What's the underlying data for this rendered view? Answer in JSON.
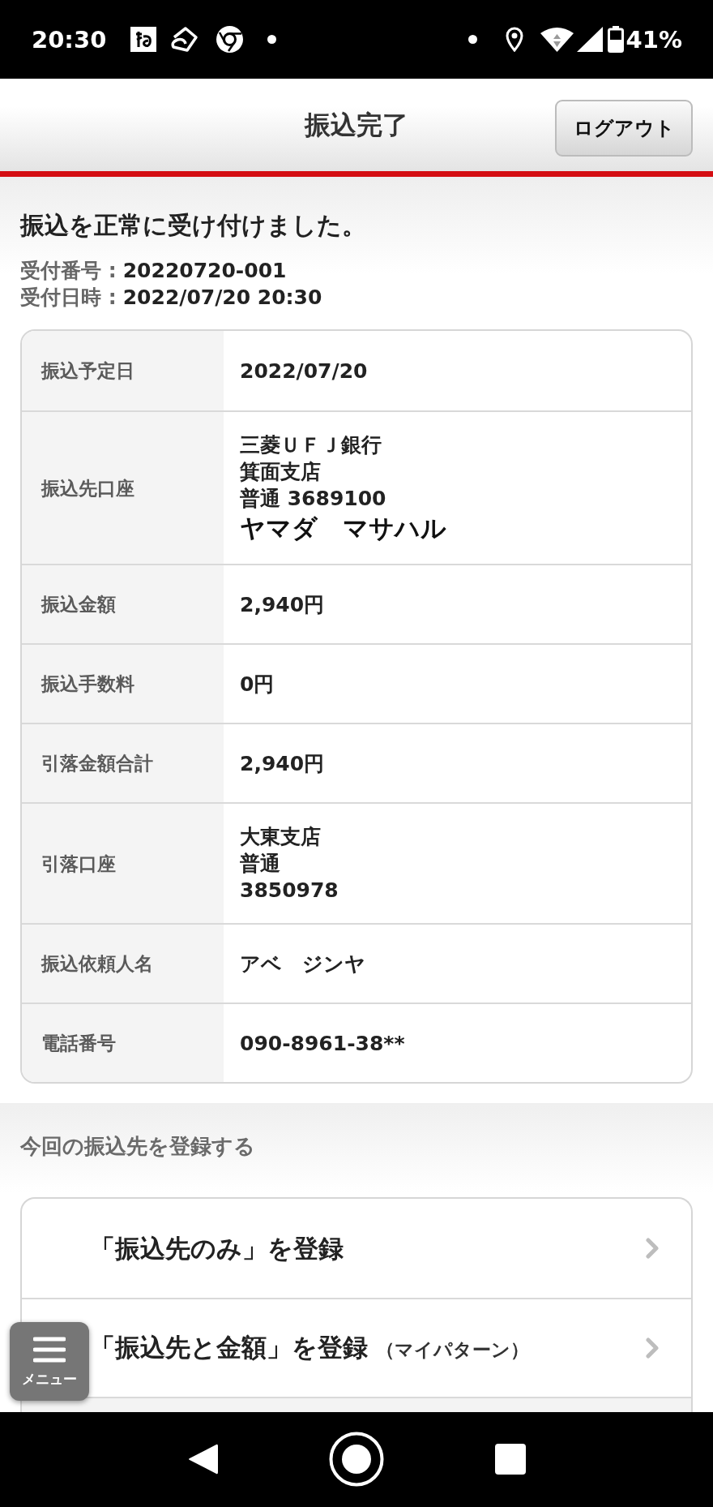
{
  "status_bar": {
    "time": "20:30",
    "battery": "41%"
  },
  "header": {
    "title": "振込完了",
    "logout_button": "ログアウト"
  },
  "message": "振込を正常に受け付けました。",
  "receipt": [
    {
      "label": "受付番号 :",
      "value": "20220720-001"
    },
    {
      "label": "受付日時 :",
      "value": "2022/07/20 20:30"
    }
  ],
  "details": [
    {
      "label": "振込予定日",
      "lines": [
        "2022/07/20"
      ]
    },
    {
      "label": "振込先口座",
      "lines": [
        "三菱ＵＦＪ銀行",
        "箕面支店",
        "普通 3689100"
      ],
      "payee_name": "ヤマダ　マサハル"
    },
    {
      "label": "振込金額",
      "lines": [
        "2,940円"
      ]
    },
    {
      "label": "振込手数料",
      "lines": [
        "0円"
      ]
    },
    {
      "label": "引落金額合計",
      "lines": [
        "2,940円"
      ]
    },
    {
      "label": "引落口座",
      "lines": [
        "大東支店",
        "普通",
        "3850978"
      ]
    },
    {
      "label": "振込依頼人名",
      "lines": [
        "アベ　ジンヤ"
      ]
    },
    {
      "label": "電話番号",
      "lines": [
        "090-8961-38**"
      ]
    }
  ],
  "register": {
    "heading": "今回の振込先を登録する",
    "items": [
      {
        "label": "「振込先のみ」を登録"
      },
      {
        "label": "「振込先と金額」を登録",
        "note": "（マイパターン）"
      }
    ]
  },
  "menu_button": {
    "label": "メニュー"
  }
}
